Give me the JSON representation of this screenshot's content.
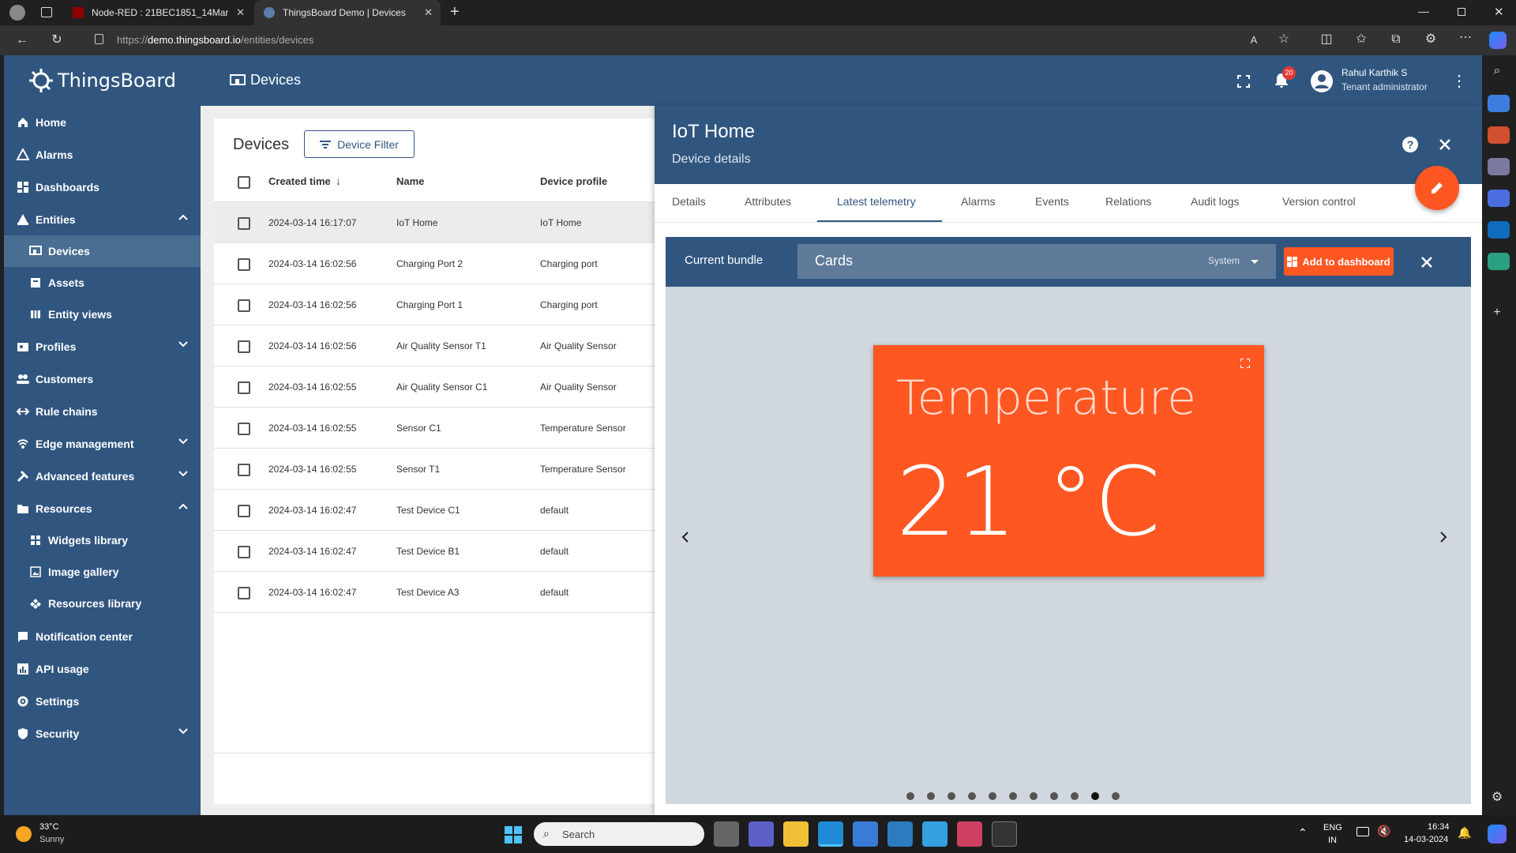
{
  "browser": {
    "tabs": [
      {
        "title": "Node-RED : 21BEC1851_14Mar",
        "active": false
      },
      {
        "title": "ThingsBoard Demo | Devices",
        "active": true
      }
    ],
    "url_scheme": "https://",
    "url_host": "demo.thingsboard.io",
    "url_path": "/entities/devices"
  },
  "app": {
    "logo_text": "ThingsBoard",
    "page_title": "Devices",
    "notification_count": "20",
    "user_name": "Rahul Karthik S",
    "user_role": "Tenant administrator"
  },
  "sidebar": {
    "items": [
      {
        "label": "Home",
        "icon": "home-icon"
      },
      {
        "label": "Alarms",
        "icon": "alarm-icon"
      },
      {
        "label": "Dashboards",
        "icon": "dashboard-icon"
      },
      {
        "label": "Entities",
        "icon": "entities-icon",
        "expanded": true
      },
      {
        "label": "Devices",
        "icon": "devices-icon",
        "selected": true
      },
      {
        "label": "Assets",
        "icon": "assets-icon"
      },
      {
        "label": "Entity views",
        "icon": "entity-views-icon"
      },
      {
        "label": "Profiles",
        "icon": "profiles-icon",
        "expanded": false
      },
      {
        "label": "Customers",
        "icon": "customers-icon"
      },
      {
        "label": "Rule chains",
        "icon": "rule-chains-icon"
      },
      {
        "label": "Edge management",
        "icon": "edge-icon",
        "expanded": false
      },
      {
        "label": "Advanced features",
        "icon": "advanced-icon",
        "expanded": false
      },
      {
        "label": "Resources",
        "icon": "resources-icon",
        "expanded": true
      },
      {
        "label": "Widgets library",
        "icon": "widgets-icon"
      },
      {
        "label": "Image gallery",
        "icon": "image-gallery-icon"
      },
      {
        "label": "Resources library",
        "icon": "resources-library-icon"
      },
      {
        "label": "Notification center",
        "icon": "notification-center-icon"
      },
      {
        "label": "API usage",
        "icon": "api-usage-icon"
      },
      {
        "label": "Settings",
        "icon": "settings-icon"
      },
      {
        "label": "Security",
        "icon": "security-icon",
        "expanded": false
      }
    ]
  },
  "devices": {
    "title": "Devices",
    "filter_label": "Device Filter",
    "columns": [
      "Created time",
      "Name",
      "Device profile"
    ],
    "rows": [
      {
        "created": "2024-03-14 16:17:07",
        "name": "IoT Home",
        "profile": "IoT Home"
      },
      {
        "created": "2024-03-14 16:02:56",
        "name": "Charging Port 2",
        "profile": "Charging port"
      },
      {
        "created": "2024-03-14 16:02:56",
        "name": "Charging Port 1",
        "profile": "Charging port"
      },
      {
        "created": "2024-03-14 16:02:56",
        "name": "Air Quality Sensor T1",
        "profile": "Air Quality Sensor"
      },
      {
        "created": "2024-03-14 16:02:55",
        "name": "Air Quality Sensor C1",
        "profile": "Air Quality Sensor"
      },
      {
        "created": "2024-03-14 16:02:55",
        "name": "Sensor C1",
        "profile": "Temperature Sensor"
      },
      {
        "created": "2024-03-14 16:02:55",
        "name": "Sensor T1",
        "profile": "Temperature Sensor"
      },
      {
        "created": "2024-03-14 16:02:47",
        "name": "Test Device C1",
        "profile": "default"
      },
      {
        "created": "2024-03-14 16:02:47",
        "name": "Test Device B1",
        "profile": "default"
      },
      {
        "created": "2024-03-14 16:02:47",
        "name": "Test Device A3",
        "profile": "default"
      }
    ]
  },
  "detail": {
    "title": "IoT Home",
    "subtitle": "Device details",
    "tabs": [
      "Details",
      "Attributes",
      "Latest telemetry",
      "Alarms",
      "Events",
      "Relations",
      "Audit logs",
      "Version control"
    ],
    "active_tab": "Latest telemetry",
    "bundle_label": "Current bundle",
    "bundle_value": "Cards",
    "bundle_scope": "System",
    "add_to_dashboard": "Add to dashboard",
    "widget_title": "Temperature",
    "widget_value": "21 °C",
    "carousel_pages": 11,
    "carousel_active_index": 9
  },
  "taskbar": {
    "weather_temp": "33°C",
    "weather_desc": "Sunny",
    "search_placeholder": "Search",
    "lang": "ENG",
    "region": "IN",
    "time": "16:34",
    "date": "14-03-2024"
  },
  "colors": {
    "primary": "#305680",
    "accent": "#ff5722",
    "selected_nav": "#4a6d92"
  }
}
